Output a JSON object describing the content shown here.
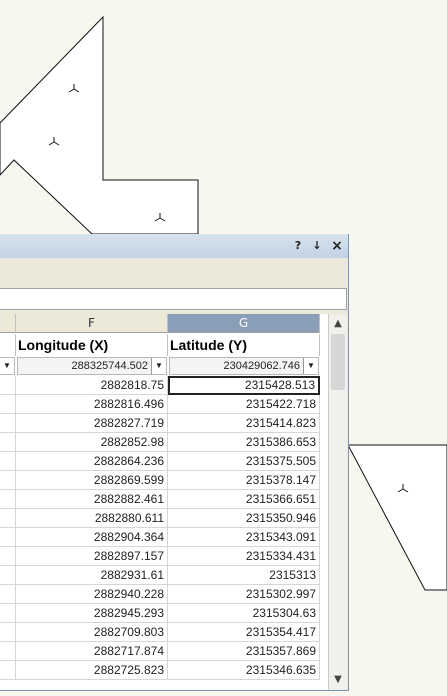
{
  "window": {
    "help_label": "?",
    "pin_label": "↓",
    "close_label": "×"
  },
  "columns": [
    {
      "letter": "F",
      "field": "Longitude (X)",
      "filter_value": "288325744.502"
    },
    {
      "letter": "G",
      "field": "Latitude (Y)",
      "filter_value": "230429062.746"
    }
  ],
  "rows": [
    [
      "2882818.75",
      "2315428.513"
    ],
    [
      "2882816.496",
      "2315422.718"
    ],
    [
      "2882827.719",
      "2315414.823"
    ],
    [
      "2882852.98",
      "2315386.653"
    ],
    [
      "2882864.236",
      "2315375.505"
    ],
    [
      "2882869.599",
      "2315378.147"
    ],
    [
      "2882882.461",
      "2315366.651"
    ],
    [
      "2882880.611",
      "2315350.946"
    ],
    [
      "2882904.364",
      "2315343.091"
    ],
    [
      "2882897.157",
      "2315334.431"
    ],
    [
      "2882931.61",
      "2315313"
    ],
    [
      "2882940.228",
      "2315302.997"
    ],
    [
      "2882945.293",
      "2315304.63"
    ],
    [
      "2882709.803",
      "2315354.417"
    ],
    [
      "2882717.874",
      "2315357.869"
    ],
    [
      "2882725.823",
      "2315346.635"
    ]
  ],
  "scrollbar": {
    "up_icon": "chevron-up-icon",
    "down_icon": "chevron-down-icon"
  }
}
